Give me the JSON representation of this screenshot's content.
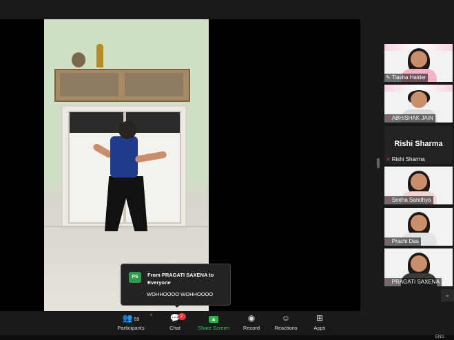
{
  "toast": {
    "avatar_initials": "PS",
    "from": "From PRAGATI SAXENA to Everyone",
    "message": "WOHHOOOO WOHHOOOO"
  },
  "gallery": [
    {
      "name": "Tiasha Halder",
      "muted": false,
      "shirt": "#f3b3c7"
    },
    {
      "name": "ABHISHAK JAIN",
      "muted": true,
      "shirt": "#d9d9d9"
    },
    {
      "name": "Rishi Sharma",
      "muted": true,
      "video_off": true,
      "display": "Rishi Sharma"
    },
    {
      "name": "Sneha Sandhya",
      "muted": true,
      "shirt": "#f0d4d4"
    },
    {
      "name": "Prachi Das",
      "muted": true,
      "shirt": "#e4e4e4"
    },
    {
      "name": "PRAGATI SAXENA",
      "muted": true,
      "shirt": "#3a3a3a"
    }
  ],
  "toolbar": {
    "participants_label": "Participants",
    "participants_count": "59",
    "chat_label": "Chat",
    "chat_badge": "2",
    "share_label": "Share Screen",
    "record_label": "Record",
    "reactions_label": "Reactions",
    "apps_label": "Apps"
  },
  "tray": {
    "lang": "ENG"
  },
  "colors": {
    "share_green": "#2bb24c",
    "badge_red": "#e0393e",
    "avatar_green": "#2e9b4a"
  },
  "icons": {
    "participants": "people-icon",
    "chat": "chat-bubble-icon",
    "share": "share-screen-icon",
    "record": "record-icon",
    "reactions": "smiley-plus-icon",
    "apps": "apps-grid-icon"
  }
}
